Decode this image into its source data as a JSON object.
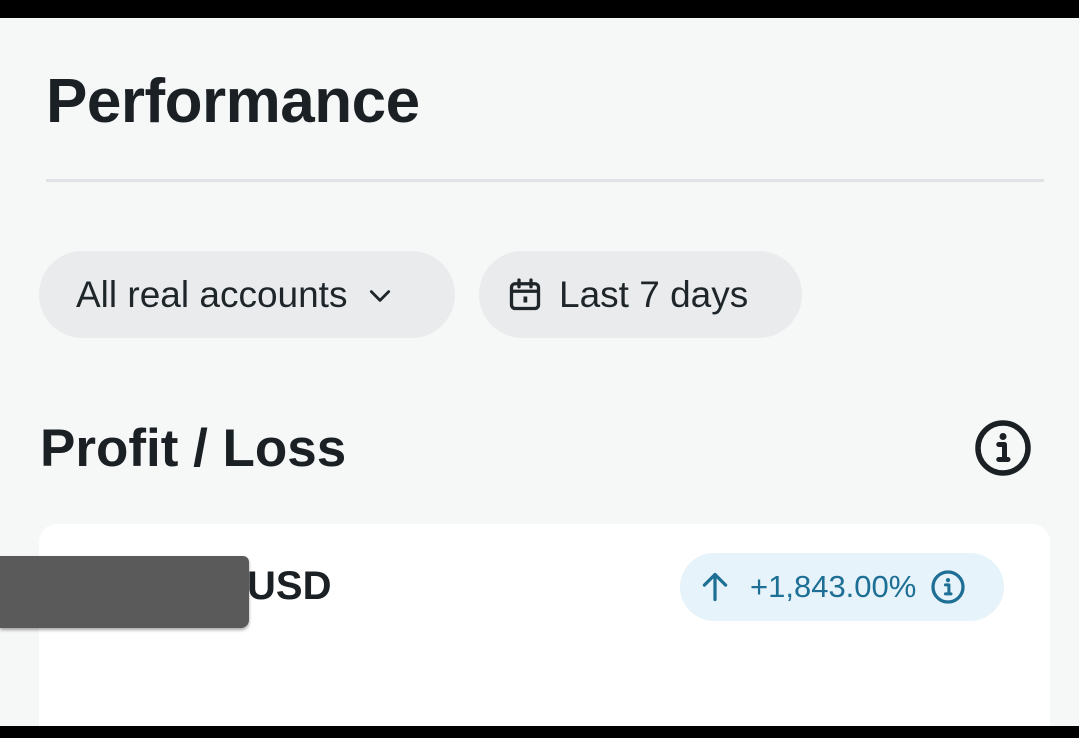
{
  "header": {
    "title": "Performance"
  },
  "filters": {
    "accounts_label": "All real accounts",
    "accounts_icon": "chevron-down-icon",
    "date_label": "Last 7 days",
    "date_icon": "calendar-icon"
  },
  "profit_loss": {
    "title": "Profit / Loss",
    "info_icon": "info-icon",
    "currency": "USD",
    "change": "+1,843.00%",
    "change_icon": "arrow-up-icon",
    "change_color": "#1d6f95"
  }
}
